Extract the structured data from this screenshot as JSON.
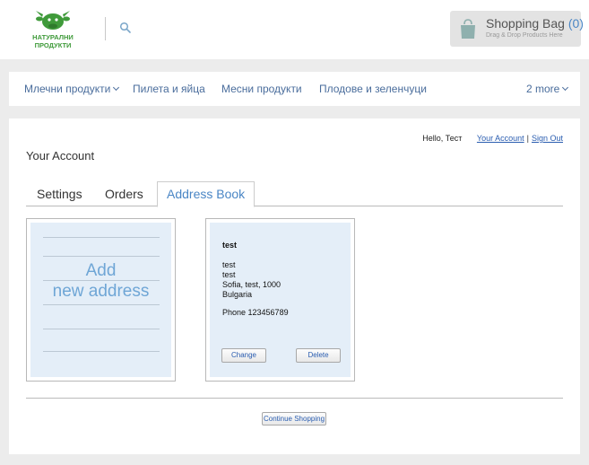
{
  "header": {
    "logo_text": [
      "НАТУРАЛНИ",
      "ПРОДУКТИ"
    ],
    "logo_icon": "cow-logo-icon",
    "search_icon": "search-icon",
    "bag": {
      "title": "Shopping Bag",
      "count": "(0)",
      "subtitle": "Drag & Drop Products Here",
      "icon": "shopping-bag-icon"
    }
  },
  "nav": {
    "items": [
      {
        "label": "Млечни продукти",
        "has_dropdown": true
      },
      {
        "label": "Пилета и яйца",
        "has_dropdown": false
      },
      {
        "label": "Месни продукти",
        "has_dropdown": false
      },
      {
        "label": "Плодове и зеленчуци",
        "has_dropdown": false
      }
    ],
    "more_label": "2 more"
  },
  "account": {
    "greeting": "Hello, Тест",
    "your_account_link": "Your Account",
    "separator": "|",
    "sign_out_link": "Sign Out",
    "page_title": "Your Account",
    "tabs": [
      {
        "label": "Settings",
        "active": false
      },
      {
        "label": "Orders",
        "active": false
      },
      {
        "label": "Address Book",
        "active": true
      }
    ],
    "add_card": {
      "line1": "Add",
      "line2": "new address"
    },
    "address": {
      "name": "test",
      "lines": [
        "test",
        "test",
        "Sofia, test, 1000",
        "Bulgaria"
      ],
      "phone": "Phone 123456789",
      "change_label": "Change",
      "delete_label": "Delete"
    },
    "continue_label": "Continue Shopping"
  },
  "colors": {
    "accent": "#4a86c5",
    "nav_text": "#4a6d9c",
    "link": "#2a5db0",
    "logo_green": "#3f9a3a",
    "card_bg": "#e4eef8"
  }
}
